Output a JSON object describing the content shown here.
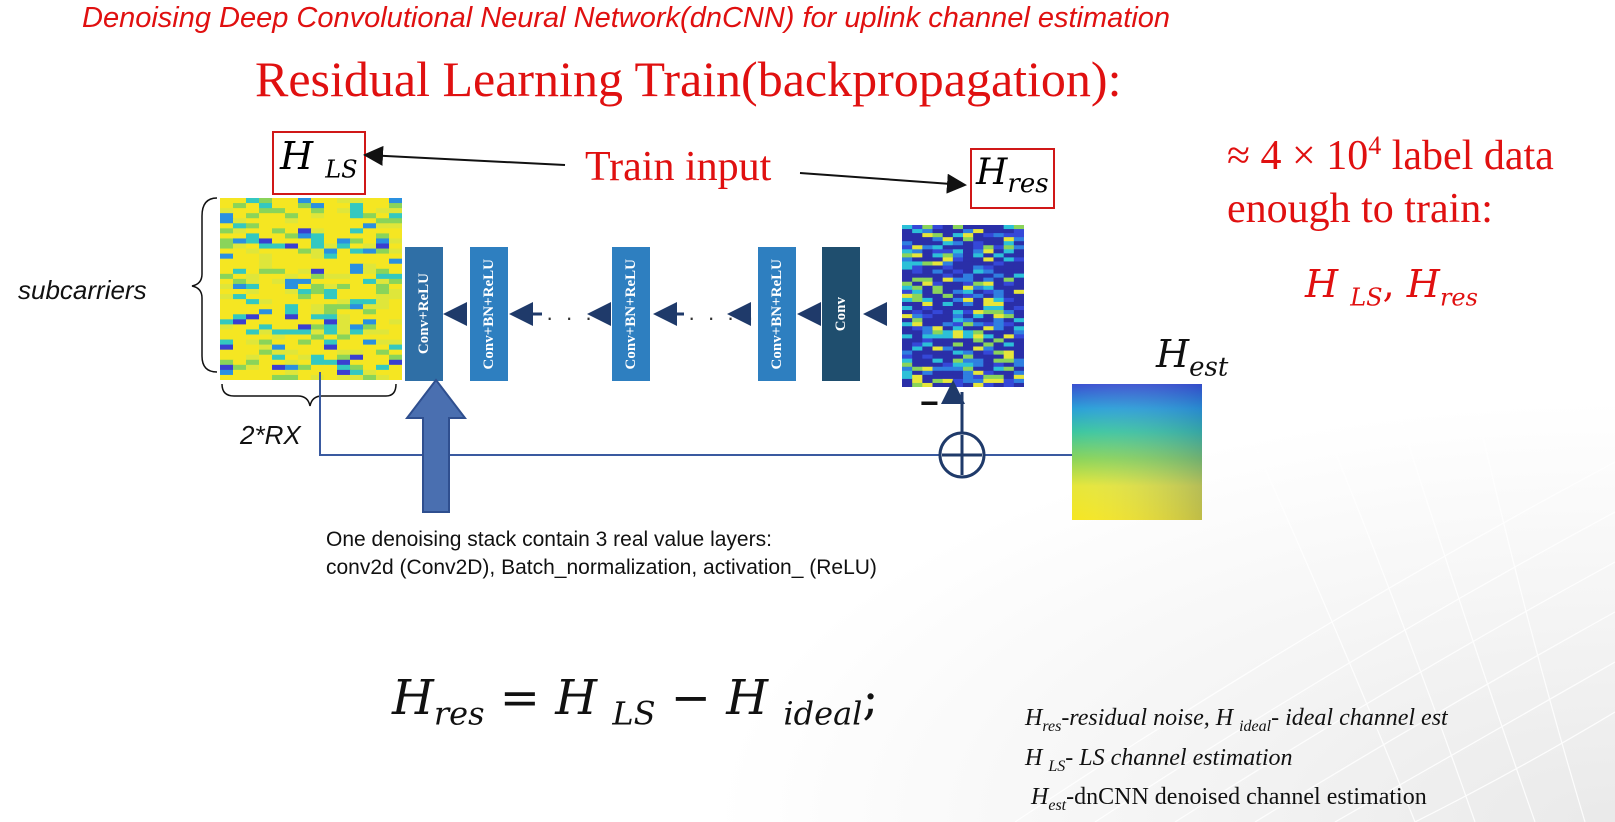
{
  "header": {
    "top_title": "Denoising Deep Convolutional Neural Network(dnCNN) for uplink channel estimation",
    "subtitle": "Residual Learning Train(backpropagation):"
  },
  "diagram": {
    "h_ls_label": "H",
    "h_ls_sub": "LS",
    "h_res_label": "H",
    "h_res_sub": "res",
    "train_input": "Train input",
    "subcarriers": "subcarriers",
    "rx": "2*RX",
    "h_est_label": "H",
    "h_est_sub": "est",
    "minus": "−",
    "layers": [
      {
        "label": "Conv+ReLU"
      },
      {
        "label": "Conv+BN+ReLU"
      },
      {
        "label": "Conv+BN+ReLU"
      },
      {
        "label": "Conv+BN+ReLU"
      },
      {
        "label": "Conv"
      }
    ],
    "dots": "· · · ·",
    "dots2": "· · · ·",
    "note_line1": "One denoising stack contain 3 real value layers:",
    "note_line2": "conv2d (Conv2D),  Batch_normalization, activation_ (ReLU)"
  },
  "side": {
    "approx": "≈ 4 × 10",
    "exp": "4",
    "label_data": " label data",
    "enough": "enough to train:",
    "list_h": "H",
    "list_ls": "LS",
    "list_sep": ", ",
    "list_h2": "H",
    "list_res": "res"
  },
  "equation": {
    "lhs_h": "H",
    "lhs_sub": "res",
    "eq": " = ",
    "h1": "H",
    "h1_sub": "LS",
    "minus": " − ",
    "h2": "H",
    "h2_sub": "ideal",
    "semi": ";"
  },
  "legend": {
    "l1_h": "H",
    "l1_sub": "res",
    "l1_text": "-residual noise, ",
    "l1_h2": "H",
    "l1_sub2": "ideal",
    "l1_text2": "- ideal channel est",
    "l2_h": "H",
    "l2_sub": "LS",
    "l2_text": "- LS channel estimation",
    "l3_h": "H",
    "l3_sub": "est",
    "l3_text": "-dnCNN denoised channel estimation"
  },
  "colors": {
    "title_red": "#e01010",
    "layer_blue": "#2e7fc0",
    "layer_dark": "#1f4e6e",
    "arrow_blue": "#4a6fb0",
    "line_blue": "#3a5aa0"
  }
}
